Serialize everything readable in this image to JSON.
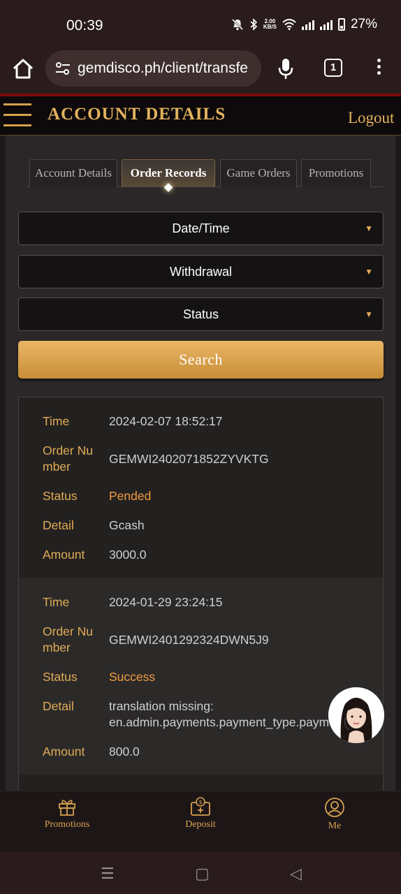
{
  "status_bar": {
    "time": "00:39",
    "net_speed_value": "2.00",
    "net_speed_unit": "KB/S",
    "battery": "27%"
  },
  "browser": {
    "url": "gemdisco.ph/client/transfe",
    "tab_count": "1"
  },
  "header": {
    "title": "ACCOUNT DETAILS",
    "logout_label": "Logout"
  },
  "tabs": [
    {
      "label": "Account Details"
    },
    {
      "label": "Order Records"
    },
    {
      "label": "Game Orders"
    },
    {
      "label": "Promotions"
    }
  ],
  "filters": {
    "datetime": "Date/Time",
    "type": "Withdrawal",
    "status": "Status"
  },
  "search_label": "Search",
  "field_labels": {
    "time": "Time",
    "order_number_line1": "Order Nu",
    "order_number_line2": "mber",
    "status": "Status",
    "detail": "Detail",
    "amount": "Amount"
  },
  "records": [
    {
      "time": "2024-02-07 18:52:17",
      "order_number": "GEMWI2402071852ZYVKTG",
      "status": "Pended",
      "detail": "Gcash",
      "amount": "3000.0"
    },
    {
      "time": "2024-01-29 23:24:15",
      "order_number": "GEMWI2401292324DWN5J9",
      "status": "Success",
      "detail_line1": "translation missing:",
      "detail_line2": "en.admin.payments.payment_type.paym",
      "amount": "800.0"
    }
  ],
  "bottom_nav": {
    "promotions": "Promotions",
    "deposit": "Deposit",
    "me": "Me"
  },
  "colors": {
    "accent_gold": "#e0ad55",
    "status_orange": "#f19d3f",
    "header_red": "#7a0b0b"
  }
}
